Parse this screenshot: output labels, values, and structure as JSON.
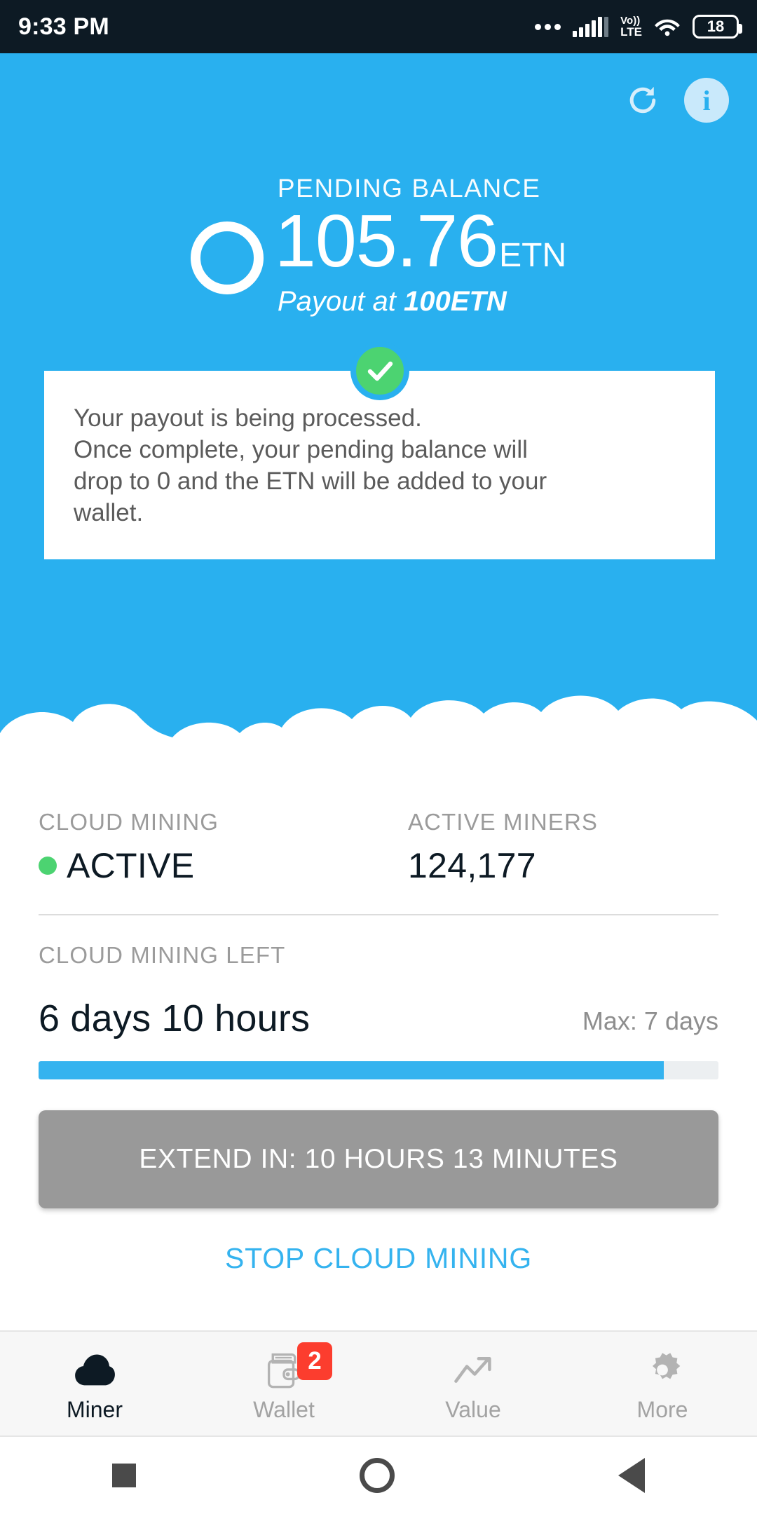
{
  "statusbar": {
    "time": "9:33 PM",
    "network_label_top": "Vo))",
    "network_label_bottom": "LTE",
    "battery_level": "18",
    "icons": [
      "more-dots-icon",
      "signal-bars-icon",
      "volte-icon",
      "wifi-icon",
      "battery-icon"
    ]
  },
  "hero": {
    "refresh_icon": "refresh-icon",
    "info_icon": "info-icon",
    "balance_label": "PENDING BALANCE",
    "balance_value": "105.76",
    "balance_unit": "ETN",
    "payout_prefix": "Payout at ",
    "payout_threshold": "100ETN",
    "accent_color": "#29b0ef"
  },
  "notice": {
    "status_icon": "check-circle-icon",
    "status_color": "#4cd371",
    "line1": "Your payout is being processed.",
    "line2": "Once complete, your pending balance will",
    "line3": "drop to 0 and the ETN will be added to your",
    "line4": "wallet."
  },
  "stats": {
    "cloud_mining_label": "CLOUD MINING",
    "cloud_mining_status": "ACTIVE",
    "cloud_mining_status_color": "#4cd371",
    "active_miners_label": "ACTIVE MINERS",
    "active_miners_value": "124,177"
  },
  "mining_left": {
    "label": "CLOUD MINING LEFT",
    "value": "6 days 10 hours",
    "max_note": "Max: 7 days",
    "progress_percent": 92
  },
  "actions": {
    "extend_button": "EXTEND IN: 10 HOURS 13 MINUTES",
    "extend_button_color": "#999999",
    "stop_link": "STOP CLOUD MINING",
    "stop_link_color": "#35b3ef"
  },
  "bottomnav": {
    "items": [
      {
        "label": "Miner",
        "icon": "cloud-icon",
        "active": true,
        "badge": ""
      },
      {
        "label": "Wallet",
        "icon": "wallet-icon",
        "active": false,
        "badge": "2"
      },
      {
        "label": "Value",
        "icon": "trending-up-icon",
        "active": false,
        "badge": ""
      },
      {
        "label": "More",
        "icon": "gear-icon",
        "active": false,
        "badge": ""
      }
    ],
    "badge_color": "#fc3d2e"
  },
  "sysnav": {
    "recent_icon": "square-recents-icon",
    "home_icon": "circle-home-icon",
    "back_icon": "triangle-back-icon"
  }
}
